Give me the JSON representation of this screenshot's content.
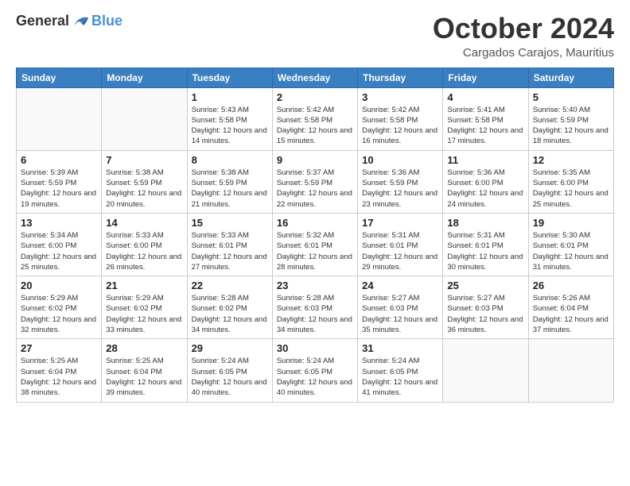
{
  "header": {
    "logo_general": "General",
    "logo_blue": "Blue",
    "month_title": "October 2024",
    "subtitle": "Cargados Carajos, Mauritius"
  },
  "days_of_week": [
    "Sunday",
    "Monday",
    "Tuesday",
    "Wednesday",
    "Thursday",
    "Friday",
    "Saturday"
  ],
  "weeks": [
    [
      {
        "day": "",
        "sunrise": "",
        "sunset": "",
        "daylight": ""
      },
      {
        "day": "",
        "sunrise": "",
        "sunset": "",
        "daylight": ""
      },
      {
        "day": "1",
        "sunrise": "Sunrise: 5:43 AM",
        "sunset": "Sunset: 5:58 PM",
        "daylight": "Daylight: 12 hours and 14 minutes."
      },
      {
        "day": "2",
        "sunrise": "Sunrise: 5:42 AM",
        "sunset": "Sunset: 5:58 PM",
        "daylight": "Daylight: 12 hours and 15 minutes."
      },
      {
        "day": "3",
        "sunrise": "Sunrise: 5:42 AM",
        "sunset": "Sunset: 5:58 PM",
        "daylight": "Daylight: 12 hours and 16 minutes."
      },
      {
        "day": "4",
        "sunrise": "Sunrise: 5:41 AM",
        "sunset": "Sunset: 5:58 PM",
        "daylight": "Daylight: 12 hours and 17 minutes."
      },
      {
        "day": "5",
        "sunrise": "Sunrise: 5:40 AM",
        "sunset": "Sunset: 5:59 PM",
        "daylight": "Daylight: 12 hours and 18 minutes."
      }
    ],
    [
      {
        "day": "6",
        "sunrise": "Sunrise: 5:39 AM",
        "sunset": "Sunset: 5:59 PM",
        "daylight": "Daylight: 12 hours and 19 minutes."
      },
      {
        "day": "7",
        "sunrise": "Sunrise: 5:38 AM",
        "sunset": "Sunset: 5:59 PM",
        "daylight": "Daylight: 12 hours and 20 minutes."
      },
      {
        "day": "8",
        "sunrise": "Sunrise: 5:38 AM",
        "sunset": "Sunset: 5:59 PM",
        "daylight": "Daylight: 12 hours and 21 minutes."
      },
      {
        "day": "9",
        "sunrise": "Sunrise: 5:37 AM",
        "sunset": "Sunset: 5:59 PM",
        "daylight": "Daylight: 12 hours and 22 minutes."
      },
      {
        "day": "10",
        "sunrise": "Sunrise: 5:36 AM",
        "sunset": "Sunset: 5:59 PM",
        "daylight": "Daylight: 12 hours and 23 minutes."
      },
      {
        "day": "11",
        "sunrise": "Sunrise: 5:36 AM",
        "sunset": "Sunset: 6:00 PM",
        "daylight": "Daylight: 12 hours and 24 minutes."
      },
      {
        "day": "12",
        "sunrise": "Sunrise: 5:35 AM",
        "sunset": "Sunset: 6:00 PM",
        "daylight": "Daylight: 12 hours and 25 minutes."
      }
    ],
    [
      {
        "day": "13",
        "sunrise": "Sunrise: 5:34 AM",
        "sunset": "Sunset: 6:00 PM",
        "daylight": "Daylight: 12 hours and 25 minutes."
      },
      {
        "day": "14",
        "sunrise": "Sunrise: 5:33 AM",
        "sunset": "Sunset: 6:00 PM",
        "daylight": "Daylight: 12 hours and 26 minutes."
      },
      {
        "day": "15",
        "sunrise": "Sunrise: 5:33 AM",
        "sunset": "Sunset: 6:01 PM",
        "daylight": "Daylight: 12 hours and 27 minutes."
      },
      {
        "day": "16",
        "sunrise": "Sunrise: 5:32 AM",
        "sunset": "Sunset: 6:01 PM",
        "daylight": "Daylight: 12 hours and 28 minutes."
      },
      {
        "day": "17",
        "sunrise": "Sunrise: 5:31 AM",
        "sunset": "Sunset: 6:01 PM",
        "daylight": "Daylight: 12 hours and 29 minutes."
      },
      {
        "day": "18",
        "sunrise": "Sunrise: 5:31 AM",
        "sunset": "Sunset: 6:01 PM",
        "daylight": "Daylight: 12 hours and 30 minutes."
      },
      {
        "day": "19",
        "sunrise": "Sunrise: 5:30 AM",
        "sunset": "Sunset: 6:01 PM",
        "daylight": "Daylight: 12 hours and 31 minutes."
      }
    ],
    [
      {
        "day": "20",
        "sunrise": "Sunrise: 5:29 AM",
        "sunset": "Sunset: 6:02 PM",
        "daylight": "Daylight: 12 hours and 32 minutes."
      },
      {
        "day": "21",
        "sunrise": "Sunrise: 5:29 AM",
        "sunset": "Sunset: 6:02 PM",
        "daylight": "Daylight: 12 hours and 33 minutes."
      },
      {
        "day": "22",
        "sunrise": "Sunrise: 5:28 AM",
        "sunset": "Sunset: 6:02 PM",
        "daylight": "Daylight: 12 hours and 34 minutes."
      },
      {
        "day": "23",
        "sunrise": "Sunrise: 5:28 AM",
        "sunset": "Sunset: 6:03 PM",
        "daylight": "Daylight: 12 hours and 34 minutes."
      },
      {
        "day": "24",
        "sunrise": "Sunrise: 5:27 AM",
        "sunset": "Sunset: 6:03 PM",
        "daylight": "Daylight: 12 hours and 35 minutes."
      },
      {
        "day": "25",
        "sunrise": "Sunrise: 5:27 AM",
        "sunset": "Sunset: 6:03 PM",
        "daylight": "Daylight: 12 hours and 36 minutes."
      },
      {
        "day": "26",
        "sunrise": "Sunrise: 5:26 AM",
        "sunset": "Sunset: 6:04 PM",
        "daylight": "Daylight: 12 hours and 37 minutes."
      }
    ],
    [
      {
        "day": "27",
        "sunrise": "Sunrise: 5:25 AM",
        "sunset": "Sunset: 6:04 PM",
        "daylight": "Daylight: 12 hours and 38 minutes."
      },
      {
        "day": "28",
        "sunrise": "Sunrise: 5:25 AM",
        "sunset": "Sunset: 6:04 PM",
        "daylight": "Daylight: 12 hours and 39 minutes."
      },
      {
        "day": "29",
        "sunrise": "Sunrise: 5:24 AM",
        "sunset": "Sunset: 6:05 PM",
        "daylight": "Daylight: 12 hours and 40 minutes."
      },
      {
        "day": "30",
        "sunrise": "Sunrise: 5:24 AM",
        "sunset": "Sunset: 6:05 PM",
        "daylight": "Daylight: 12 hours and 40 minutes."
      },
      {
        "day": "31",
        "sunrise": "Sunrise: 5:24 AM",
        "sunset": "Sunset: 6:05 PM",
        "daylight": "Daylight: 12 hours and 41 minutes."
      },
      {
        "day": "",
        "sunrise": "",
        "sunset": "",
        "daylight": ""
      },
      {
        "day": "",
        "sunrise": "",
        "sunset": "",
        "daylight": ""
      }
    ]
  ]
}
